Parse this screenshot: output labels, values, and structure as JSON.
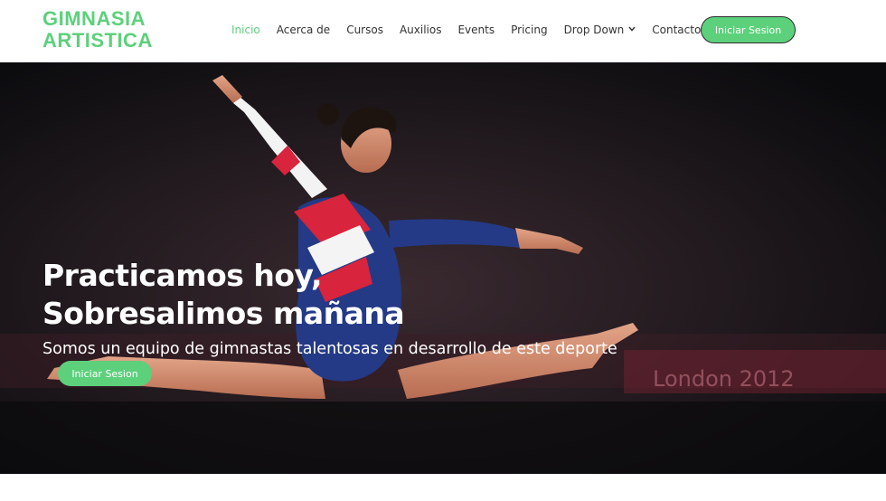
{
  "brand": {
    "line1": "GIMNASIA",
    "line2": "ARTISTICA",
    "color": "#5dd07c"
  },
  "nav": {
    "items": [
      {
        "label": "Inicio",
        "active": true
      },
      {
        "label": "Acerca de"
      },
      {
        "label": "Cursos"
      },
      {
        "label": "Auxilios"
      },
      {
        "label": "Events"
      },
      {
        "label": "Pricing"
      },
      {
        "label": "Drop Down",
        "has_dropdown": true
      },
      {
        "label": "Contacto"
      }
    ],
    "login_label": "Iniciar Sesion"
  },
  "hero": {
    "title_line1": "Practicamos hoy,",
    "title_line2": "Sobresalimos mañana",
    "subtitle": "Somos un equipo de gimnastas talentosas en desarrollo de este deporte",
    "button_label": "Iniciar Sesion",
    "background_banner_text": "London 2012",
    "image": "gymnast-split-leap-photo"
  },
  "colors": {
    "accent": "#5dd07c",
    "text_dark": "#333333",
    "hero_overlay": "#0d0d10"
  }
}
